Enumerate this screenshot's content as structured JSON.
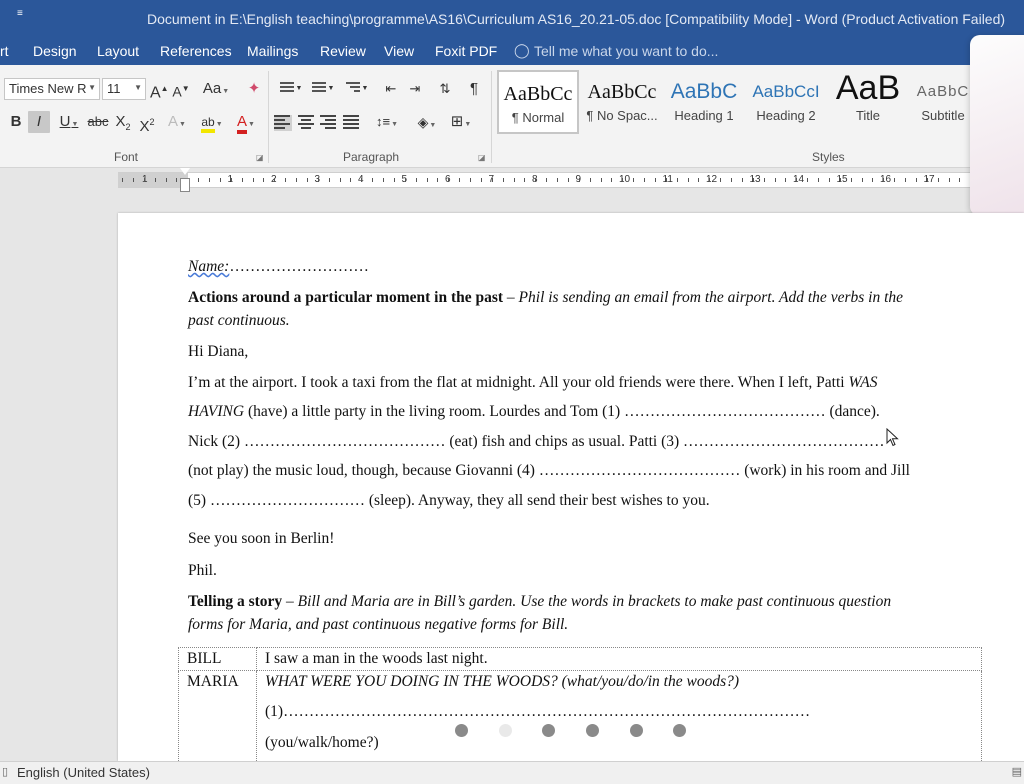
{
  "window": {
    "title": "Document in E:\\English teaching\\programme\\AS16\\Curriculum AS16_20.21-05.doc [Compatibility Mode] - Word (Product Activation Failed)",
    "qat_glyph": "≡"
  },
  "ribbon_tabs": [
    "rt",
    "Design",
    "Layout",
    "References",
    "Mailings",
    "Review",
    "View",
    "Foxit PDF"
  ],
  "tell_me": {
    "placeholder": "Tell me what you want to do..."
  },
  "font_group": {
    "label": "Font",
    "font_name": "Times New R",
    "font_size": "11",
    "grow": "A",
    "shrink": "A",
    "change_case": "Aa",
    "bold": "B",
    "italic": "I",
    "underline": "U",
    "strike": "abc",
    "subscript": "X",
    "superscript": "X",
    "text_effects": "A",
    "highlight": "ab",
    "font_color": "A",
    "colors": {
      "highlight": "#f2e600",
      "font": "#d32020"
    }
  },
  "paragraph_group": {
    "label": "Paragraph",
    "pilcrow": "¶"
  },
  "styles_group": {
    "label": "Styles",
    "items": [
      {
        "sample": "AaBbCc",
        "name": "¶ Normal"
      },
      {
        "sample": "AaBbCc",
        "name": "¶ No Spac..."
      },
      {
        "sample": "AaBbC",
        "name": "Heading 1"
      },
      {
        "sample": "AaBbCcI",
        "name": "Heading 2"
      },
      {
        "sample": "AaB",
        "name": "Title"
      },
      {
        "sample": "AaBbC",
        "name": "Subtitle"
      }
    ]
  },
  "ruler": {
    "numbers": [
      "1",
      "1",
      "2",
      "3",
      "4",
      "5",
      "6",
      "7",
      "8",
      "9",
      "10",
      "11",
      "12",
      "13",
      "14",
      "15",
      "16",
      "17"
    ]
  },
  "document": {
    "name_label": "Name:",
    "name_dots": "………………………",
    "s1_title": "Actions around a particular moment in the past",
    "s1_dash": " – ",
    "s1_instr_a": "Phil is sending an email from the airport. Add the verbs in the",
    "s1_instr_b": "past continuous.",
    "greeting": "Hi Diana,",
    "p1": "I’m at the airport. I took a taxi from the flat at midnight. All your old friends were there. When I left, Patti ",
    "p1_ital": "WAS",
    "p2_ital": "HAVING",
    "p2": " (have) a little party in the living room. Lourdes and Tom (1) ………………………………… (dance).",
    "p3": "Nick (2) ………………………………… (eat) fish and chips as usual. Patti (3) …………………………………",
    "p4": "(not play) the music loud, though, because Giovanni (4) ………………………………… (work) in his room and Jill",
    "p5": "(5) ………………………… (sleep). Anyway, they all send their best wishes to you.",
    "closing": "See you soon in Berlin!",
    "signature": "Phil.",
    "s2_title": "Telling a story",
    "s2_dash": " – ",
    "s2_instr_a": "Bill and Maria are in Bill’s garden. Use the words in brackets to make past continuous question",
    "s2_instr_b": "forms for Maria, and past continuous negative forms for Bill.",
    "table": [
      {
        "speaker": "BILL",
        "line": "I saw a man in the woods last night."
      },
      {
        "speaker": "MARIA",
        "line_ital": "WHAT WERE YOU DOING IN THE WOODS? (what/you/do/in the woods?)",
        "line2": "(1)…………………………………………………………………………………………",
        "line3": "(you/walk/home?)"
      }
    ]
  },
  "status_bar": {
    "language": "English (United States)"
  }
}
